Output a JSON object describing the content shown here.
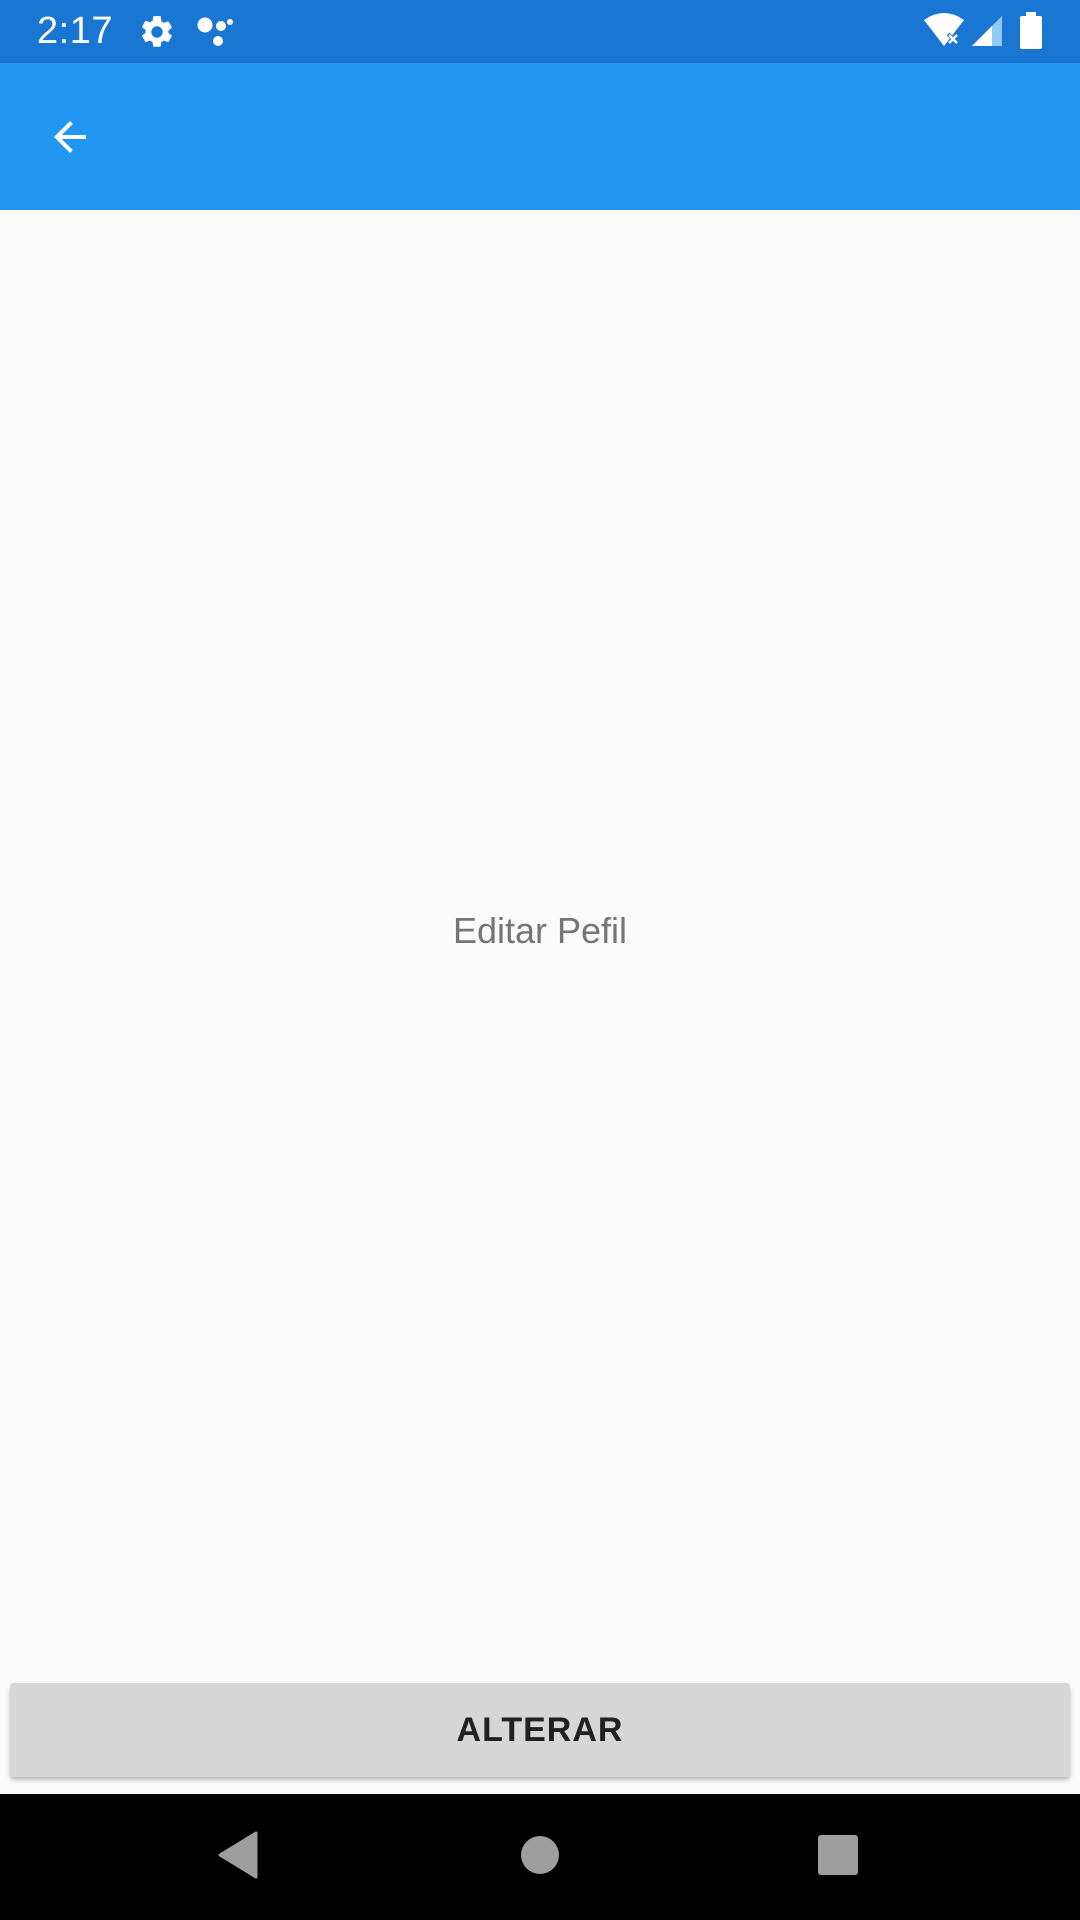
{
  "status_bar": {
    "time": "2:17",
    "icons": [
      "gear-icon",
      "assistant-dots-icon",
      "wifi-off-icon",
      "signal-icon",
      "battery-icon"
    ],
    "background": "#1976D2"
  },
  "app_bar": {
    "background": "#2196F3",
    "back_icon": "arrow-left-icon"
  },
  "main": {
    "center_text": "Editar Pefil"
  },
  "actions": {
    "alterar_label": "ALTERAR"
  },
  "nav_bar": {
    "icons": [
      "back-triangle-icon",
      "home-circle-icon",
      "recents-square-icon"
    ]
  }
}
